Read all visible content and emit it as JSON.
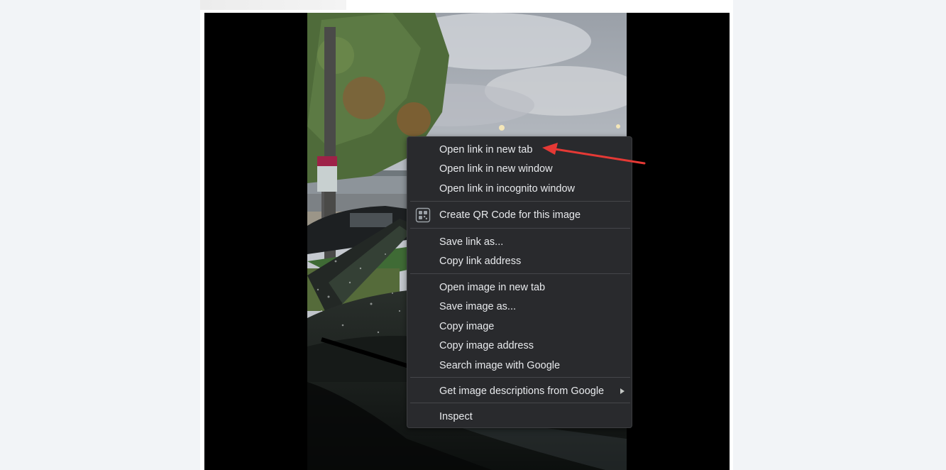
{
  "context_menu": {
    "items": {
      "open_new_tab": "Open link in new tab",
      "open_new_window": "Open link in new window",
      "open_incognito": "Open link in incognito window",
      "create_qr": "Create QR Code for this image",
      "save_link": "Save link as...",
      "copy_link": "Copy link address",
      "open_image_tab": "Open image in new tab",
      "save_image": "Save image as...",
      "copy_image": "Copy image",
      "copy_image_address": "Copy image address",
      "search_image": "Search image with Google",
      "image_descriptions": "Get image descriptions from Google",
      "inspect": "Inspect"
    },
    "icons": {
      "qr": "qr-code-icon",
      "submenu": "chevron-right-icon"
    }
  },
  "annotation": {
    "color": "#e53935"
  },
  "colors": {
    "menu_bg": "#292a2d",
    "menu_text": "#e8eaed",
    "page_bg": "#f2f4f7",
    "media_bg": "#000000"
  }
}
